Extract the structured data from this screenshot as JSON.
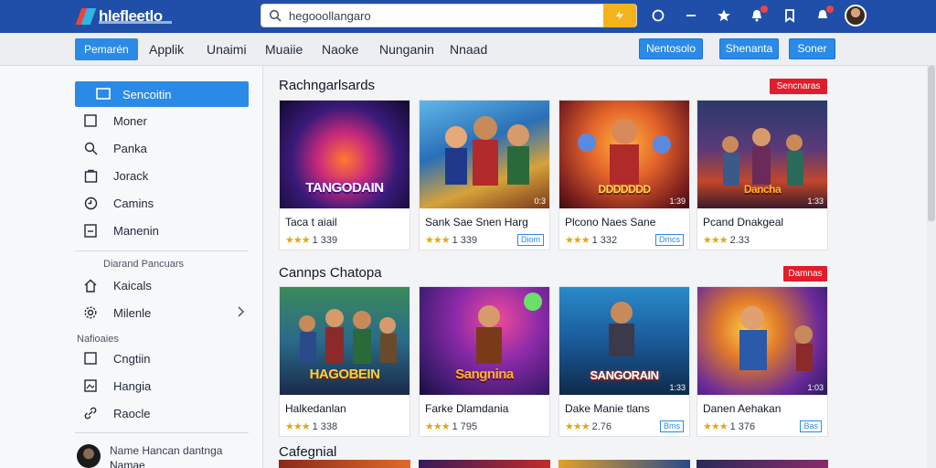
{
  "topbar": {
    "brand": "hlefleetlo",
    "search_value": "hegooollangaro",
    "colors": {
      "bar": "#1f4fa8",
      "search_button": "#f5b31b",
      "accent": "#2b8ae6",
      "alert": "#e11d2c"
    }
  },
  "nav": {
    "tabs": [
      "Pemarén",
      "Applik",
      "Unaimi",
      "Muaiie",
      "Naoke",
      "Nunganin",
      "Nnaad"
    ],
    "buttons": [
      "Nentosolo",
      "Shenanta",
      "Soner"
    ]
  },
  "sidebar": {
    "items": [
      {
        "label": "Sencoitin",
        "icon": "screen-icon"
      },
      {
        "label": "Moner",
        "icon": "square-icon"
      },
      {
        "label": "Panka",
        "icon": "search-icon"
      },
      {
        "label": "Jorack",
        "icon": "bag-icon"
      },
      {
        "label": "Camins",
        "icon": "clock-icon"
      },
      {
        "label": "Manenin",
        "icon": "doc-icon"
      }
    ],
    "heading1": "Diarand Pancuars",
    "items2": [
      {
        "label": "Kaicals",
        "icon": "home-icon"
      },
      {
        "label": "Milenle",
        "icon": "gear-icon"
      }
    ],
    "heading2": "Nafioaies",
    "items3": [
      {
        "label": "Cngtiin",
        "icon": "square-icon"
      },
      {
        "label": "Hangia",
        "icon": "image-icon"
      },
      {
        "label": "Raocle",
        "icon": "link-icon"
      }
    ],
    "user": {
      "line1": "Name Hancan dantnga",
      "line2": "Namae"
    }
  },
  "sections": [
    {
      "title": "Rachngarlsards",
      "badge": "Sencnaras",
      "cards": [
        {
          "overlay": "TANGODAIN",
          "tag": "",
          "title": "Taca t aiail",
          "rating": "1 339",
          "chip": ""
        },
        {
          "overlay": "",
          "tag": "0:3",
          "title": "Sank  Sae Snen Harg",
          "rating": "1 339",
          "chip": "Diom"
        },
        {
          "overlay": "DDDDDDD",
          "tag": "1:39",
          "title": "Plcono Naes Sane",
          "rating": "1 332",
          "chip": "Dmcs"
        },
        {
          "overlay": "Dancha",
          "tag": "1:33",
          "title": "Pcand Dnakgeal",
          "rating": "2.33",
          "chip": ""
        }
      ]
    },
    {
      "title": "Cannps Chatopa",
      "badge": "Damnas",
      "cards": [
        {
          "overlay": "HAGOBEIN",
          "tag": "",
          "title": "Halkedanlan",
          "rating": "1 338",
          "chip": ""
        },
        {
          "overlay": "Sangnina",
          "tag": "",
          "title": "Farke Dlamdania",
          "rating": "1 795",
          "chip": ""
        },
        {
          "overlay": "SANGORAIN",
          "tag": "1:33",
          "title": "Dake Manie tlans",
          "rating": "2.76",
          "chip": "Bms"
        },
        {
          "overlay": "",
          "tag": "1:03",
          "title": "Danen Aehakan",
          "rating": "1 376",
          "chip": "Bas"
        }
      ]
    }
  ],
  "third_section": {
    "title": "Cafegnial"
  }
}
